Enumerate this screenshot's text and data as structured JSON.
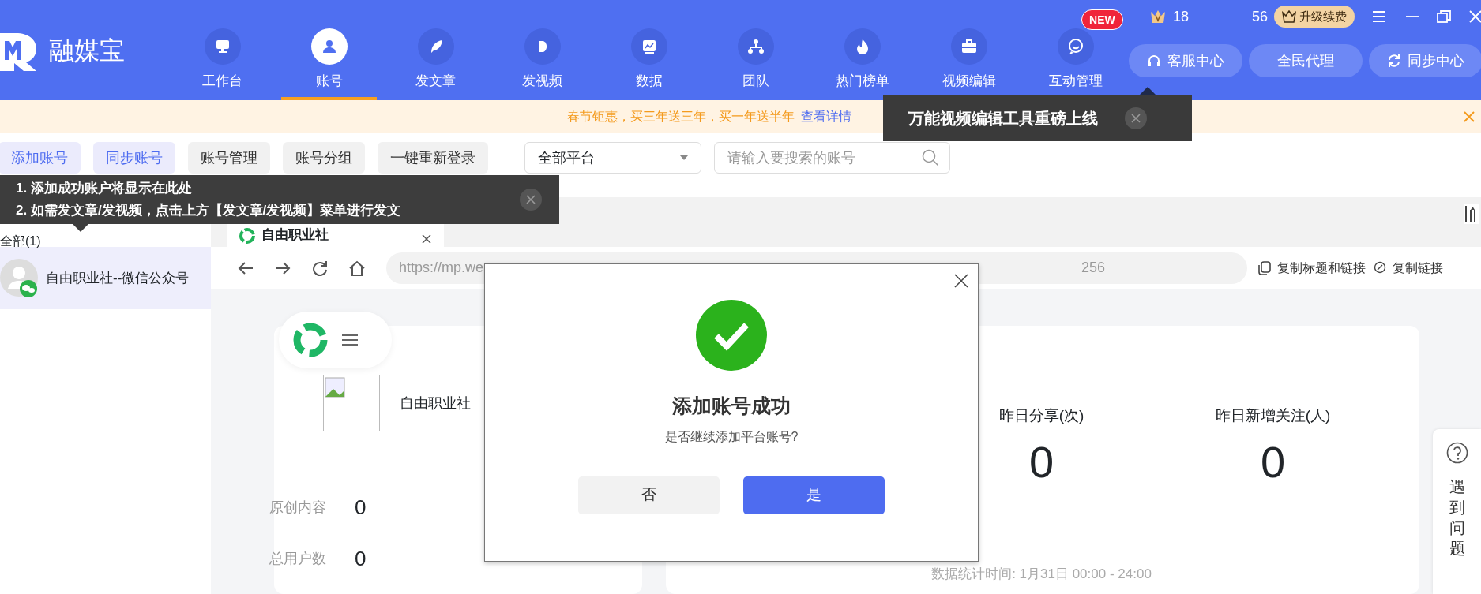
{
  "app": {
    "logo_text": "融媒宝"
  },
  "nav": [
    {
      "label": "工作台",
      "selected": false
    },
    {
      "label": "账号",
      "selected": true
    },
    {
      "label": "发文章",
      "selected": false
    },
    {
      "label": "发视频",
      "selected": false
    },
    {
      "label": "数据",
      "selected": false
    },
    {
      "label": "团队",
      "selected": false
    },
    {
      "label": "热门榜单",
      "selected": false
    },
    {
      "label": "视频编辑",
      "selected": false
    },
    {
      "label": "互动管理",
      "selected": false,
      "badge": "NEW"
    }
  ],
  "top_right": {
    "vip_count": "18",
    "count_2": "56",
    "upgrade": "升级续费"
  },
  "header_buttons": [
    "客服中心",
    "全民代理",
    "同步中心"
  ],
  "banner": {
    "text": "春节钜惠，买三年送三年，买一年送半年",
    "link": "查看详情"
  },
  "popup_tip": {
    "text": "万能视频编辑工具重磅上线"
  },
  "toolbar": {
    "buttons": [
      {
        "label": "添加账号",
        "kind": "accent"
      },
      {
        "label": "同步账号",
        "kind": "accent"
      },
      {
        "label": "账号管理",
        "kind": "plain"
      },
      {
        "label": "账号分组",
        "kind": "plain"
      },
      {
        "label": "一键重新登录",
        "kind": "plain"
      }
    ],
    "platform_select": "全部平台",
    "search_placeholder": "请输入要搜索的账号"
  },
  "guide_tip": {
    "lines": [
      "1. 添加成功账户将显示在此处",
      "2. 如需发文章/发视频，点击上方【发文章/发视频】菜单进行发文"
    ]
  },
  "account_filter": "全部(1)",
  "accounts": [
    {
      "name": "自由职业社--微信公众号",
      "selected": true
    }
  ],
  "browser_tab": {
    "title": "自由职业社"
  },
  "address_bar": {
    "url_start": "https://mp.we",
    "url_end": "256"
  },
  "copy_actions": [
    "复制标题和链接",
    "复制链接"
  ],
  "profile": {
    "name": "自由职业社",
    "stats": [
      {
        "label": "原创内容",
        "value": "0"
      },
      {
        "label": "总用户数",
        "value": "0"
      }
    ]
  },
  "summary": {
    "stats": [
      {
        "label": "昨日分享(次)",
        "value": "0"
      },
      {
        "label": "昨日新增关注(人)",
        "value": "0"
      }
    ],
    "footnote": "数据统计时间: 1月31日 00:00 - 24:00"
  },
  "help": {
    "label": "遇到问题"
  },
  "dialog": {
    "title": "添加账号成功",
    "message": "是否继续添加平台账号?",
    "buttons": [
      {
        "label": "否",
        "kind": "secondary"
      },
      {
        "label": "是",
        "kind": "primary"
      }
    ]
  }
}
